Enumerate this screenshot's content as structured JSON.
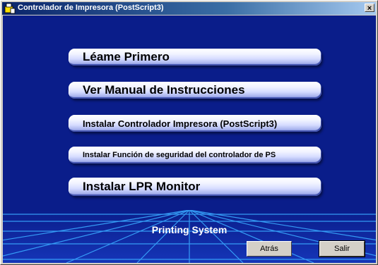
{
  "window": {
    "title": "Controlador de Impresora (PostScript3)",
    "close_label": "×"
  },
  "menu": {
    "items": [
      {
        "label": "Léame Primero"
      },
      {
        "label": "Ver Manual de Instrucciones"
      },
      {
        "label": "Instalar Controlador Impresora (PostScript3)"
      },
      {
        "label": "Instalar Función de seguridad del controlador de PS"
      },
      {
        "label": "Instalar LPR Monitor"
      }
    ]
  },
  "footer": {
    "label": "Printing System",
    "back_label": "Atrás",
    "exit_label": "Salir"
  },
  "colors": {
    "background": "#0a1d8a",
    "titlebar_start": "#0a246a",
    "titlebar_end": "#a6caf0"
  }
}
